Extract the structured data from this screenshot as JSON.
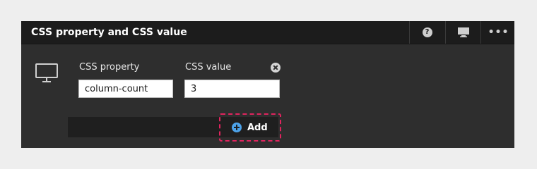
{
  "header": {
    "title": "CSS property and CSS value",
    "buttons": [
      {
        "icon": "help-icon",
        "glyph": "?"
      },
      {
        "icon": "monitor-icon"
      },
      {
        "icon": "more-icon",
        "glyph": "•••"
      }
    ]
  },
  "row": {
    "device_icon": "monitor-icon",
    "property_label": "CSS property",
    "value_label": "CSS value",
    "property_value": "column-count",
    "value_value": "3",
    "remove_icon": "close-circle-icon"
  },
  "add": {
    "label": "Add",
    "icon": "plus-circle-icon",
    "highlight_color": "#e0245e",
    "icon_color": "#4da3ea"
  }
}
